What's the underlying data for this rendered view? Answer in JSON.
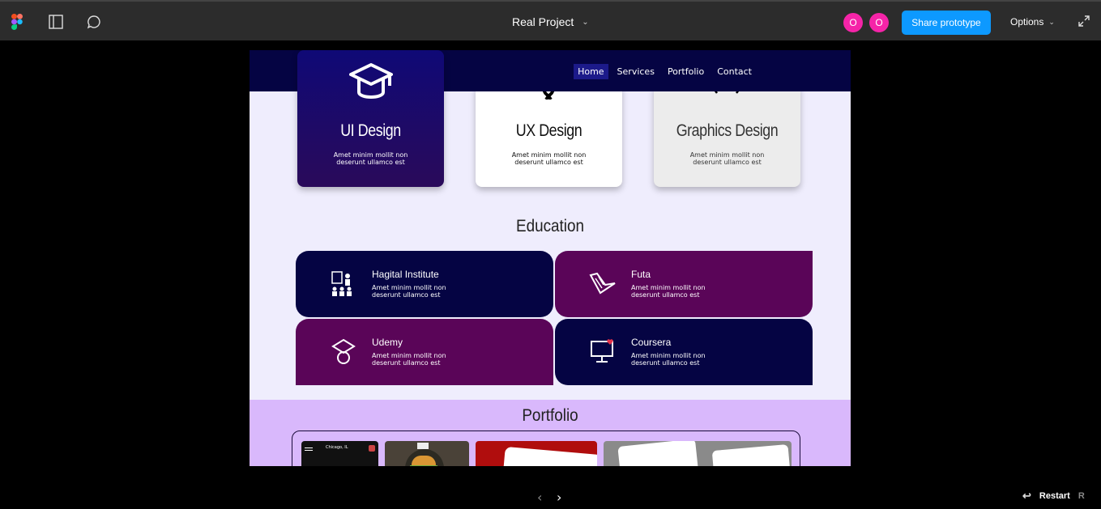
{
  "toolbar": {
    "project_title": "Real Project",
    "avatars": [
      "O",
      "O"
    ],
    "share_label": "Share prototype",
    "options_label": "Options"
  },
  "site": {
    "nav": [
      "Home",
      "Services",
      "Portfolio",
      "Contact"
    ],
    "services": [
      {
        "title": "UI Design",
        "desc": "Amet minim mollit non deserunt ullamco est"
      },
      {
        "title": "UX Design",
        "desc": "Amet minim mollit non deserunt ullamco est"
      },
      {
        "title": "Graphics Design",
        "desc": "Amet minim mollit non deserunt ullamco est"
      }
    ],
    "education_heading": "Education",
    "education": [
      {
        "name": "Hagital Institute",
        "desc": "Amet minim mollit non deserunt ullamco est"
      },
      {
        "name": "Futa",
        "desc": "Amet minim mollit non deserunt ullamco est"
      },
      {
        "name": "Udemy",
        "desc": "Amet minim mollit non deserunt ullamco est"
      },
      {
        "name": "Coursera",
        "desc": "Amet minim mollit non deserunt ullamco est"
      }
    ],
    "portfolio_heading": "Portfolio",
    "thumb_text": "Chicago, IL"
  },
  "footer": {
    "restart_label": "Restart",
    "restart_key": "R"
  },
  "colors": {
    "navy": "#050443",
    "plum": "#5a0558",
    "accent": "#0d99ff",
    "avatar": "#f524a8"
  }
}
